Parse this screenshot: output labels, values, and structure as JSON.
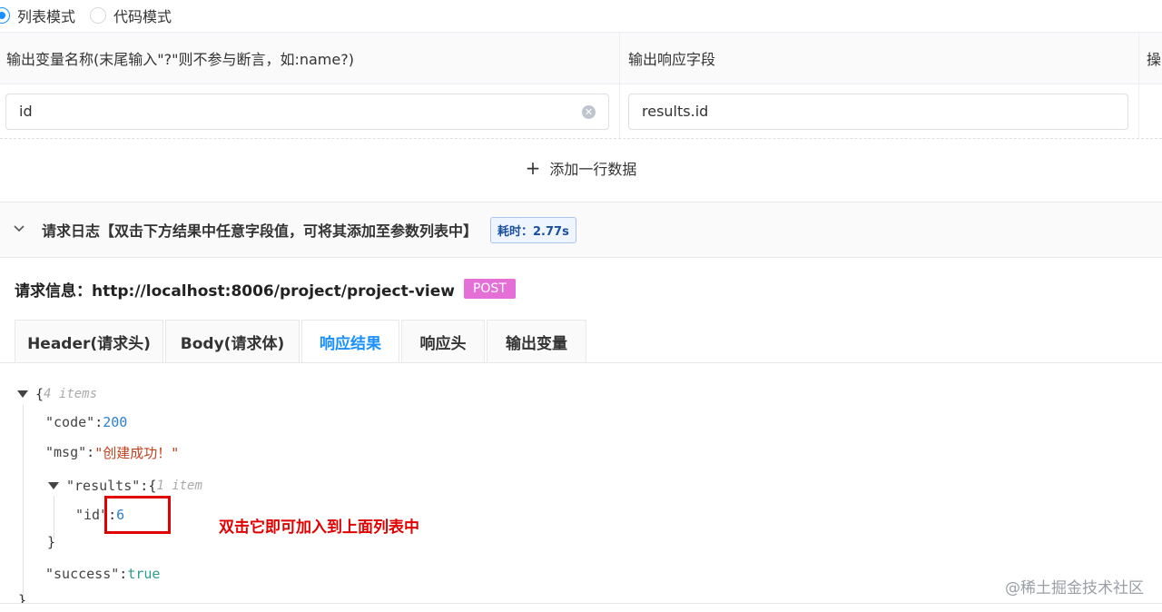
{
  "mode": {
    "list_label": "列表模式",
    "code_label": "代码模式",
    "selected": "list"
  },
  "table": {
    "headers": [
      "输出变量名称(末尾输入\"?\"则不参与断言，如:name?)",
      "输出响应字段",
      "操"
    ],
    "rows": [
      {
        "name": "id",
        "field": "results.id"
      }
    ],
    "add_row_label": "添加一行数据"
  },
  "log": {
    "title": "请求日志【双击下方结果中任意字段值，可将其添加至参数列表中】",
    "time_label": "耗时：2.77s",
    "request_info": "请求信息：http://localhost:8006/project/project-view",
    "method": "POST"
  },
  "tabs": [
    {
      "label": "Header(请求头)"
    },
    {
      "label": "Body(请求体)"
    },
    {
      "label": "响应结果"
    },
    {
      "label": "响应头"
    },
    {
      "label": "输出变量"
    }
  ],
  "active_tab": 2,
  "json": {
    "open_brace": "{",
    "root_meta": "4 items",
    "code_key": "\"code\"",
    "code_value": "200",
    "msg_key": "\"msg\"",
    "msg_value": "\"创建成功！\"",
    "results_key": "\"results\"",
    "results_meta": "1 item",
    "id_key": "\"id\"",
    "id_value": "6",
    "close_brace": "}",
    "success_key": "\"success\"",
    "success_value": "true",
    "colon": ":"
  },
  "annotation": "双击它即可加入到上面列表中",
  "watermark": "@稀土掘金技术社区",
  "icons": {
    "clear": "clear-icon",
    "plus": "plus-icon",
    "chevron": "chevron-down-icon",
    "caret": "caret-down-icon"
  },
  "colors": {
    "primary": "#1890ff",
    "post_badge": "#e46fd6",
    "annotation_red": "#e00000"
  }
}
